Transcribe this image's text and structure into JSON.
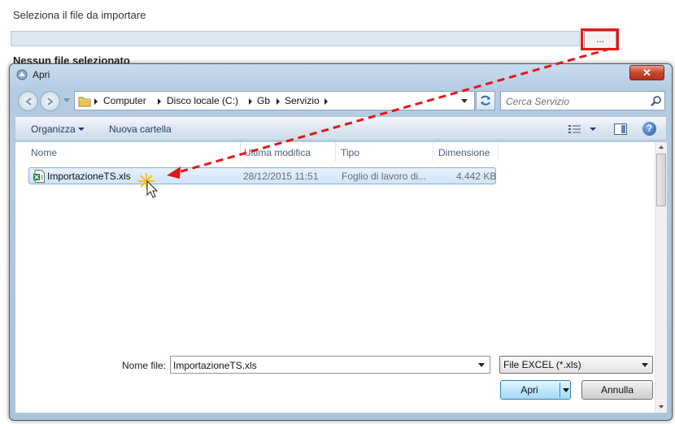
{
  "page": {
    "heading": "Seleziona il file da importare",
    "browse_label": "...",
    "status": "Nessun file selezionato"
  },
  "dialog": {
    "title": "Apri",
    "close_label": "✕",
    "breadcrumb": [
      "Computer",
      "Disco locale (C:)",
      "Gb",
      "Servizio"
    ],
    "search_placeholder": "Cerca Servizio",
    "toolbar": {
      "organize": "Organizza",
      "new_folder": "Nuova cartella"
    },
    "columns": [
      "Nome",
      "Ultima modifica",
      "Tipo",
      "Dimensione"
    ],
    "files": [
      {
        "name": "ImportazioneTS.xls",
        "modified": "28/12/2015 11:51",
        "type": "Foglio di lavoro di...",
        "size": "4.442 KB",
        "selected": true
      }
    ],
    "filename_label": "Nome file:",
    "filename_value": "ImportazioneTS.xls",
    "filetype_value": "File EXCEL (*.xls)",
    "open_label": "Apri",
    "cancel_label": "Annulla"
  },
  "colors": {
    "highlight": "#e11818",
    "selection": "#cfe4fa",
    "window_frame": "#b5cde3"
  },
  "icons": [
    "app-icon",
    "back-icon",
    "forward-icon",
    "folder-icon",
    "refresh-icon",
    "search-icon",
    "views-icon",
    "preview-pane-icon",
    "help-icon",
    "excel-file-icon",
    "cursor-icon"
  ]
}
